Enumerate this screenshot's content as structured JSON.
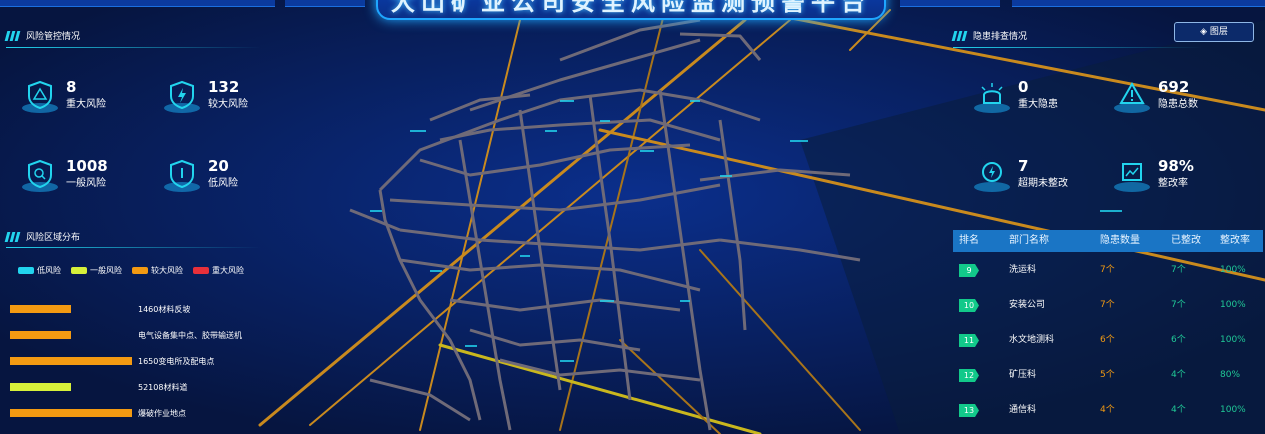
{
  "header": {
    "title": "大山矿业公司安全风险监测预警平台"
  },
  "risk_control": {
    "title": "风险管控情况",
    "stats": [
      {
        "value": "8",
        "label": "重大风险"
      },
      {
        "value": "132",
        "label": "较大风险"
      },
      {
        "value": "1008",
        "label": "一般风险"
      },
      {
        "value": "20",
        "label": "低风险"
      }
    ]
  },
  "risk_zones": {
    "title": "风险区域分布",
    "legend": [
      {
        "label": "低风险",
        "color": "#22d4ee"
      },
      {
        "label": "一般风险",
        "color": "#d6f03a"
      },
      {
        "label": "较大风险",
        "color": "#f39a12"
      },
      {
        "label": "重大风险",
        "color": "#e8303a"
      }
    ],
    "rows": [
      {
        "label": "1460材料反坡",
        "level": "较大风险",
        "fill_fraction": 0.5
      },
      {
        "label": "电气设备集中点、胶带输送机",
        "level": "较大风险",
        "fill_fraction": 0.5
      },
      {
        "label": "1650变电所及配电点",
        "level": "较大风险",
        "fill_fraction": 1.0
      },
      {
        "label": "52108材料道",
        "level": "一般风险",
        "fill_fraction": 0.5
      },
      {
        "label": "爆破作业地点",
        "level": "较大风险",
        "fill_fraction": 1.0
      }
    ]
  },
  "hazard_check": {
    "title": "隐患排查情况",
    "layer_button": "图层",
    "stats": [
      {
        "value": "0",
        "label": "重大隐患"
      },
      {
        "value": "692",
        "label": "隐患总数"
      },
      {
        "value": "7",
        "label": "超期未整改"
      },
      {
        "value": "98%",
        "label": "整改率"
      }
    ]
  },
  "ranking_table": {
    "headers": [
      "排名",
      "部门名称",
      "隐患数量",
      "已整改",
      "整改率"
    ],
    "rows": [
      {
        "rank": "9",
        "dept": "洗运科",
        "count": "7个",
        "fixed": "7个",
        "rate": "100%"
      },
      {
        "rank": "10",
        "dept": "安装公司",
        "count": "7个",
        "fixed": "7个",
        "rate": "100%"
      },
      {
        "rank": "11",
        "dept": "水文地测科",
        "count": "6个",
        "fixed": "6个",
        "rate": "100%"
      },
      {
        "rank": "12",
        "dept": "矿压科",
        "count": "5个",
        "fixed": "4个",
        "rate": "80%"
      },
      {
        "rank": "13",
        "dept": "通信科",
        "count": "4个",
        "fixed": "4个",
        "rate": "100%"
      }
    ]
  },
  "colors": {
    "accent": "#22d4ee",
    "count_orange": "#f39a12",
    "fixed_green": "#20c997",
    "rate_green": "#20c997",
    "rank_green": "#12c98a"
  }
}
